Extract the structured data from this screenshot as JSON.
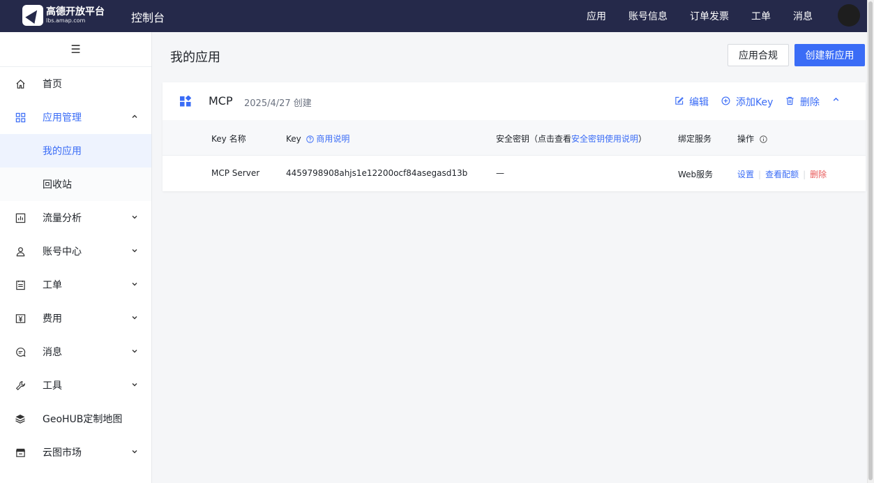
{
  "topbar": {
    "logo_main": "高德开放平台",
    "logo_sub": "lbs.amap.com",
    "console_title": "控制台",
    "nav": [
      "应用",
      "账号信息",
      "订单发票",
      "工单",
      "消息"
    ]
  },
  "sidebar": {
    "toggle_icon": "☰",
    "items": [
      {
        "label": "首页",
        "icon": "home-icon"
      },
      {
        "label": "应用管理",
        "icon": "grid-icon"
      },
      {
        "label": "我的应用"
      },
      {
        "label": "回收站"
      },
      {
        "label": "流量分析",
        "icon": "chart-icon"
      },
      {
        "label": "账号中心",
        "icon": "user-icon"
      },
      {
        "label": "工单",
        "icon": "ticket-icon"
      },
      {
        "label": "费用",
        "icon": "yen-icon"
      },
      {
        "label": "消息",
        "icon": "message-icon"
      },
      {
        "label": "工具",
        "icon": "wrench-icon"
      },
      {
        "label": "GeoHUB定制地图",
        "icon": "layers-icon"
      },
      {
        "label": "云图市场",
        "icon": "store-icon"
      }
    ]
  },
  "main": {
    "title": "我的应用",
    "compliance_button": "应用合规",
    "create_button": "创建新应用"
  },
  "app": {
    "name": "MCP",
    "created": "2025/4/27 创建",
    "edit_label": "编辑",
    "add_key_label": "添加Key",
    "delete_label": "删除"
  },
  "table": {
    "headers": {
      "key_name": "Key 名称",
      "key": "Key",
      "key_help_link": "商用说明",
      "secret_prefix": "安全密钥（点击查看",
      "secret_link": "安全密钥使用说明",
      "secret_suffix": "）",
      "service": "绑定服务",
      "ops": "操作"
    },
    "rows": [
      {
        "key_name": "MCP Server",
        "key": "4459798908ahjs1e12200ocf84asegasd13b",
        "secret": "—",
        "service": "Web服务",
        "op_settings": "设置",
        "op_quota": "查看配额",
        "op_delete": "删除"
      }
    ]
  },
  "colors": {
    "topbar": "#25294a",
    "accent": "#3a6cf6",
    "danger": "#e85a5a"
  }
}
